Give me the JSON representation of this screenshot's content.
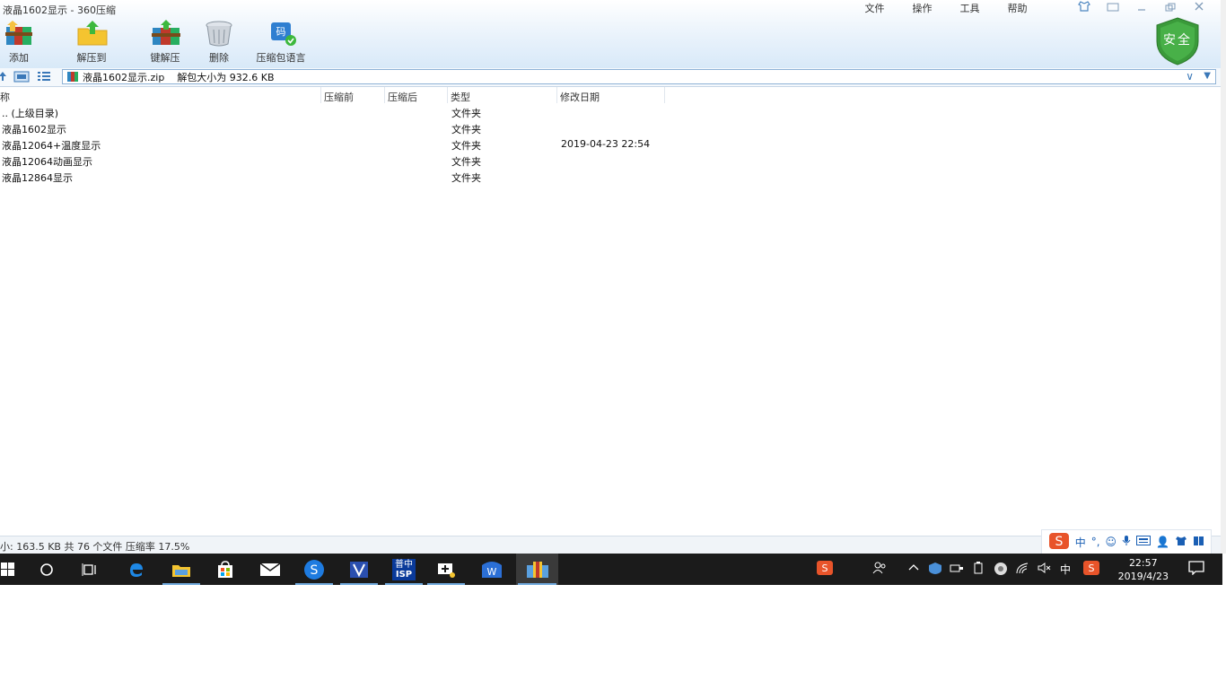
{
  "window": {
    "title": "液晶1602显示 - 360压缩"
  },
  "menu": [
    "文件",
    "操作",
    "工具",
    "帮助"
  ],
  "toolbar": {
    "add": "添加",
    "extract_to": "解压到",
    "one_click": "键解压",
    "delete": "删除",
    "lang": "压缩包语言"
  },
  "shield": {
    "label": "安全",
    "color": "#3a9a3a"
  },
  "path": {
    "archive": "液晶1602显示.zip",
    "size_text": "解包大小为 932.6 KB"
  },
  "columns": {
    "name": "称",
    "before": "压缩前",
    "after": "压缩后",
    "type": "类型",
    "modified": "修改日期"
  },
  "files": [
    {
      "name": ".. (上级目录)",
      "type": "文件夹",
      "date": ""
    },
    {
      "name": "液晶1602显示",
      "type": "文件夹",
      "date": ""
    },
    {
      "name": "液晶12064+温度显示",
      "type": "文件夹",
      "date": "2019-04-23 22:54"
    },
    {
      "name": "液晶12064动画显示",
      "type": "文件夹",
      "date": ""
    },
    {
      "name": "液晶12864显示",
      "type": "文件夹",
      "date": ""
    }
  ],
  "status": {
    "text": "小: 163.5 KB 共 76 个文件 压缩率 17.5%"
  },
  "ime": {
    "lang": "中"
  },
  "taskbar": {
    "isp_label": "ISP",
    "isp_top": "普中",
    "tray_lang": "中",
    "time": "22:57",
    "date": "2019/4/23"
  }
}
